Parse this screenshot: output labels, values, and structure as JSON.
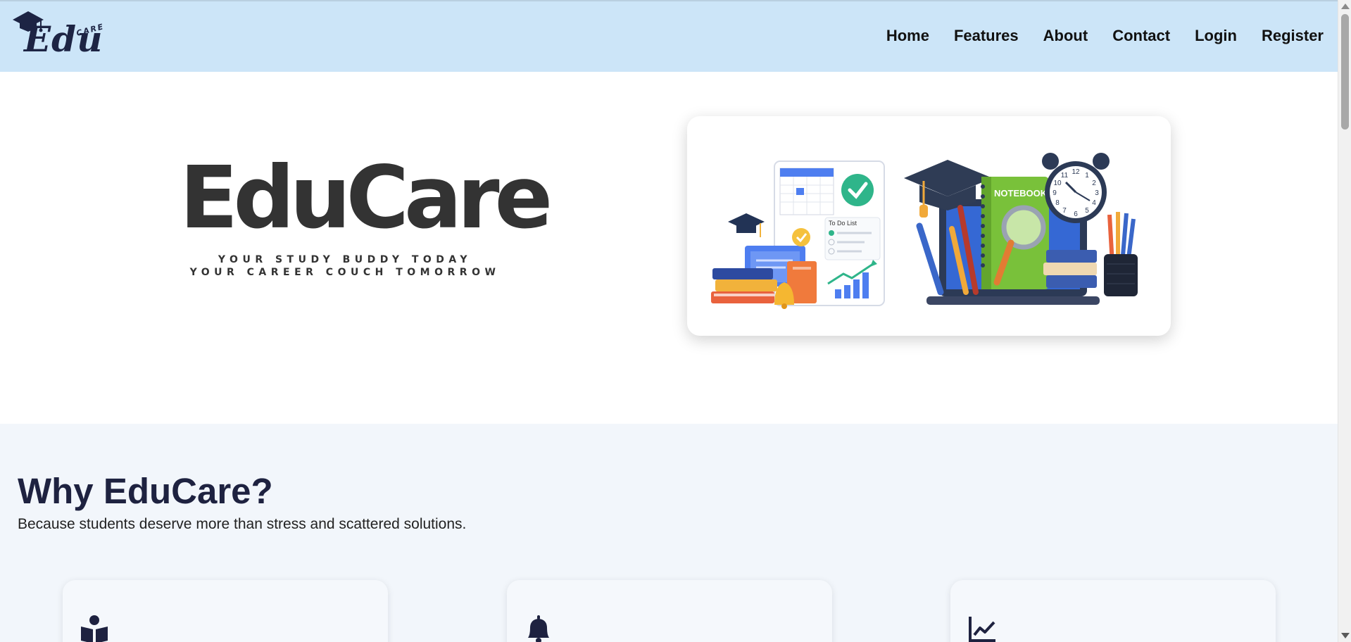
{
  "app": {
    "logo": {
      "word": "Edu",
      "sub": "CARE",
      "icon": "graduation-cap-icon"
    }
  },
  "nav": {
    "items": [
      {
        "label": "Home"
      },
      {
        "label": "Features"
      },
      {
        "label": "About"
      },
      {
        "label": "Contact"
      },
      {
        "label": "Login"
      },
      {
        "label": "Register"
      }
    ]
  },
  "hero": {
    "brand": "EduCare",
    "tagline_1": "YOUR STUDY BUDDY TODAY",
    "tagline_2": "YOUR CAREER COUCH TOMORROW",
    "illustration": {
      "todo_title": "To Do List",
      "notebook_label": "NOTEBOOK",
      "clock_numbers": [
        "12",
        "1",
        "2",
        "3",
        "4",
        "5",
        "6",
        "7",
        "8",
        "9",
        "10",
        "11"
      ]
    }
  },
  "why": {
    "title": "Why EduCare?",
    "subtitle": "Because students deserve more than stress and scattered solutions.",
    "cards": [
      {
        "icon": "book-reader-icon"
      },
      {
        "icon": "bell-icon"
      },
      {
        "icon": "chart-line-icon"
      }
    ]
  },
  "colors": {
    "navbar_bg": "#cce5f8",
    "section_bg": "#f2f6fb",
    "heading": "#1e2240",
    "brand_text": "#333333"
  }
}
